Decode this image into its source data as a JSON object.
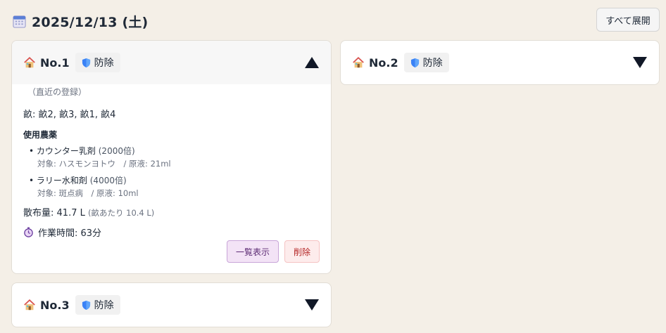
{
  "header": {
    "date": "2025/12/13 (土)",
    "calendar_icon": "calendar-icon",
    "expand_all_label": "すべて展開"
  },
  "cards": [
    {
      "no": "No.1",
      "badge": "防除",
      "expanded": true,
      "recent": "（直近の登録）",
      "fields_label": "畝:",
      "fields_value": "畝2, 畝3, 畝1, 畝4",
      "pesticides_title": "使用農薬",
      "pesticides": [
        {
          "name": "カウンター乳剤",
          "ratio": "(2000倍)",
          "detail": "対象: ハスモンヨトウ　/ 原液: 21ml"
        },
        {
          "name": "ラリー水和剤",
          "ratio": "(4000倍)",
          "detail": "対象: 斑点病　/ 原液: 10ml"
        }
      ],
      "amount_label": "散布量:",
      "amount_value": "41.7 L",
      "amount_per": "(畝あたり 10.4 L)",
      "worktime": "作業時間: 63分",
      "list_button": "一覧表示",
      "delete_button": "削除"
    },
    {
      "no": "No.2",
      "badge": "防除",
      "expanded": false
    },
    {
      "no": "No.3",
      "badge": "防除",
      "expanded": false
    }
  ],
  "colors": {
    "background": "#f4efe7",
    "card": "#ffffff",
    "list_button_bg": "#f3e3f6",
    "delete_button_bg": "#fdecec",
    "shield": "#3b82f6"
  }
}
